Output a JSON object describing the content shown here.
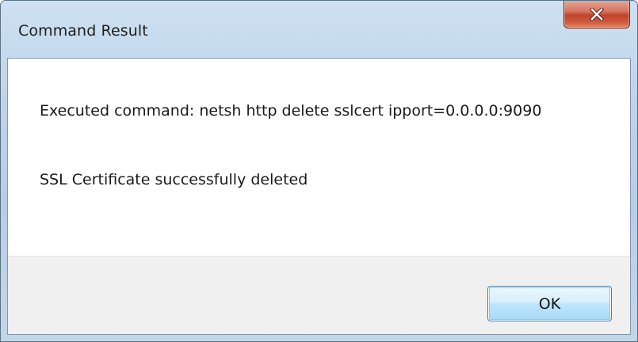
{
  "window": {
    "title": "Command Result",
    "close_icon": "close-icon"
  },
  "message": {
    "command_line": "Executed command: netsh http delete sslcert ipport=0.0.0.0:9090",
    "result_line": "SSL Certificate successfully deleted"
  },
  "buttons": {
    "ok_label": "OK"
  },
  "colors": {
    "close_button": "#c7462c",
    "ok_button_border": "#3c7fb1",
    "button_area_bg": "#f0f0f0",
    "titlebar": "#bdd4ea"
  }
}
